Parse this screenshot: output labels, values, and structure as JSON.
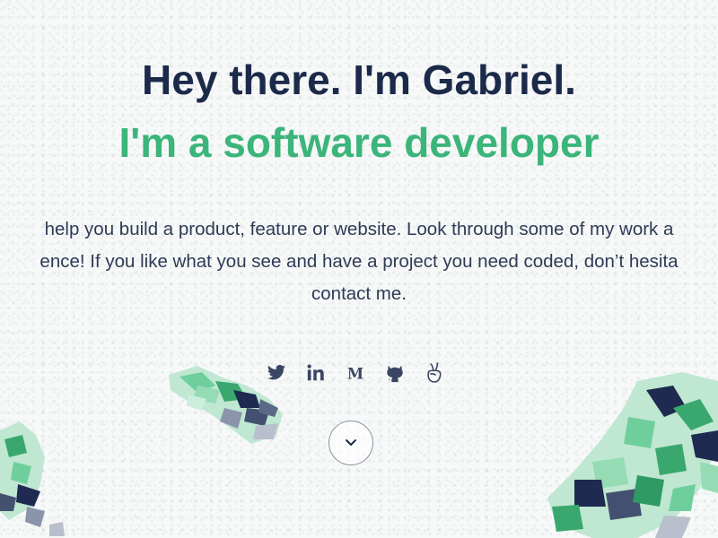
{
  "hero": {
    "greeting": "Hey there. I'm Gabriel.",
    "role": "I'm a software developer",
    "intro_lines": [
      "help you build a product, feature or website. Look through some of my work a",
      "ence! If you like what you see and have a project you need coded, don’t hesita",
      "contact me."
    ]
  },
  "socials": [
    {
      "name": "twitter-icon"
    },
    {
      "name": "linkedin-icon"
    },
    {
      "name": "medium-icon"
    },
    {
      "name": "github-icon"
    },
    {
      "name": "angellist-icon"
    }
  ],
  "scroll_button": {
    "icon": "chevron-down-icon"
  },
  "colors": {
    "heading": "#1c2a4a",
    "accent": "#3bb57a",
    "body_text": "#2f3b56",
    "icon": "#3a4663"
  }
}
